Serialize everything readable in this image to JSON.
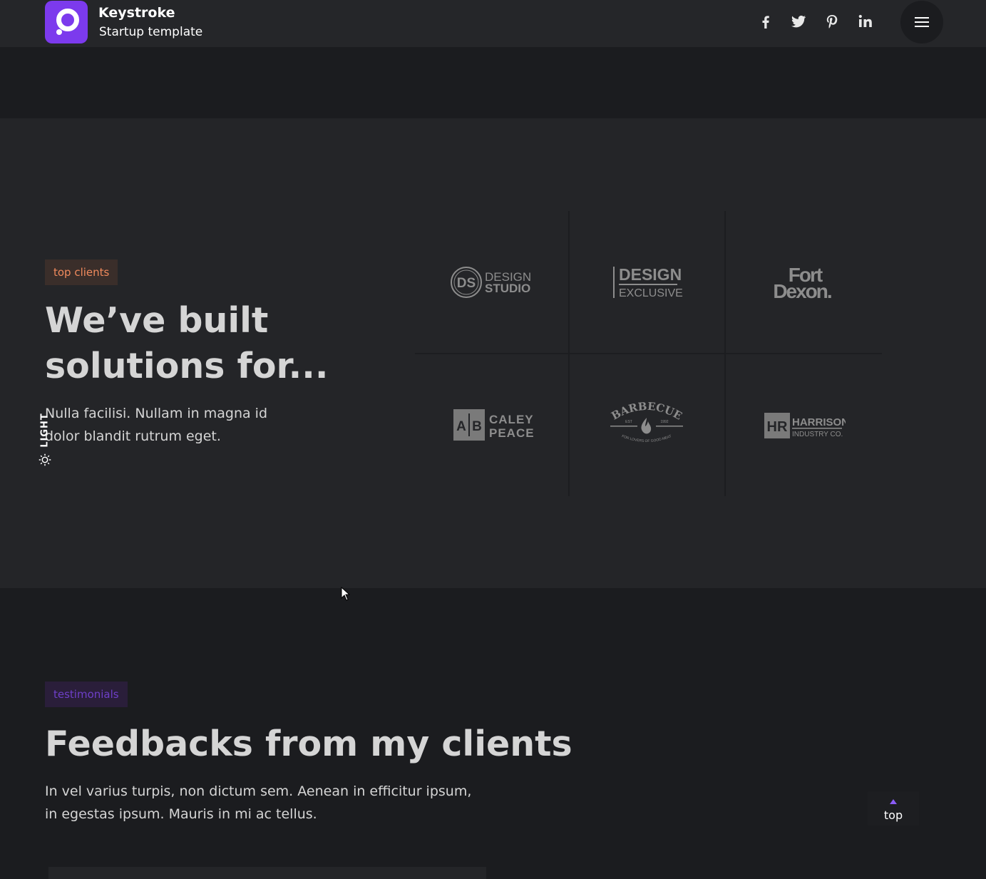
{
  "header": {
    "brand_title": "Keystroke",
    "brand_subtitle": "Startup template",
    "logo_icon": "logo-ring-icon",
    "social": [
      "facebook-icon",
      "twitter-icon",
      "pinterest-icon",
      "linkedin-icon"
    ],
    "menu_icon": "hamburger-icon",
    "accent_color": "#7c3aed"
  },
  "clients": {
    "badge": "top clients",
    "heading": "We’ve built solutions for...",
    "paragraph": "Nulla facilisi. Nullam in magna id dolor blandit rutrum eget.",
    "mode_label": "LIGHT",
    "logos": [
      {
        "name": "design-studio",
        "mark": "DS",
        "line1": "DESIGN",
        "line2": "STUDIO"
      },
      {
        "name": "design-exclusive",
        "line1": "DESIGN",
        "line2": "EXCLUSIVE"
      },
      {
        "name": "fort-dexon",
        "line1": "Fort",
        "line2": "Dexon."
      },
      {
        "name": "caley-peace",
        "mark_a": "A",
        "mark_b": "B",
        "line1": "CALEY",
        "line2": "PEACE"
      },
      {
        "name": "barbecue",
        "line1": "BARBECUE",
        "est": "EST",
        "year": "1992",
        "tagline": "FOR LOVERS OF GOOD MEAT"
      },
      {
        "name": "harrison",
        "mark": "HR",
        "line1": "HARRISON",
        "line2": "INDUSTRY CO."
      }
    ]
  },
  "testimonials": {
    "badge": "testimonials",
    "heading": "Feedbacks from my clients",
    "paragraph": "In vel varius turpis, non dictum sem. Aenean in efficitur ipsum, in egestas ipsum. Mauris in mi ac tellus."
  },
  "back_to_top": {
    "label": "top",
    "icon": "arrow-up-icon"
  }
}
